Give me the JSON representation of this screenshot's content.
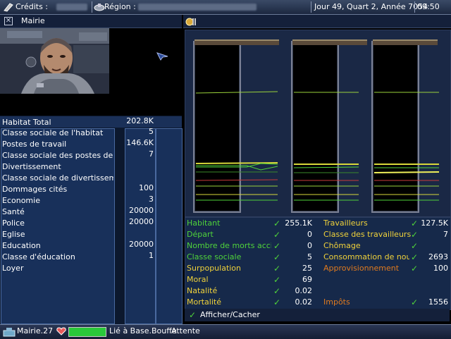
{
  "topbar": {
    "credits_label": "Crédits :",
    "region_label": "Région :",
    "date": "Jour 49, Quart 2, Année 7054",
    "clock": "09:50"
  },
  "left_panel": {
    "title": "Mairie",
    "rows": [
      {
        "label": "Habitat Total",
        "value": "202.8K"
      },
      {
        "label": "Classe sociale de l'habitat",
        "value": "5"
      },
      {
        "label": "Postes de travail",
        "value": "146.6K"
      },
      {
        "label": "Classe sociale des postes de trav",
        "value": "7"
      },
      {
        "label": "Divertissement",
        "value": ""
      },
      {
        "label": "Classe sociale de divertissement",
        "value": ""
      },
      {
        "label": "Dommages cités",
        "value": "100"
      },
      {
        "label": "Economie",
        "value": "3"
      },
      {
        "label": "Santé",
        "value": "20000"
      },
      {
        "label": "Police",
        "value": "20000"
      },
      {
        "label": "Eglise",
        "value": ""
      },
      {
        "label": "Education",
        "value": "20000"
      },
      {
        "label": "Classe d'éducation",
        "value": "1"
      },
      {
        "label": "Loyer",
        "value": ""
      }
    ]
  },
  "stats": {
    "left": [
      {
        "label": "Habitant",
        "value": "255.1K"
      },
      {
        "label": "Départ",
        "value": "0"
      },
      {
        "label": "Nombre de morts acciden",
        "value": "0"
      },
      {
        "label": "Classe sociale",
        "value": "5"
      },
      {
        "label": "Surpopulation",
        "value": "25"
      },
      {
        "label": "Moral",
        "value": "69"
      },
      {
        "label": "Natalité",
        "value": "0.02"
      },
      {
        "label": "Mortalité",
        "value": "0.02"
      }
    ],
    "right": [
      {
        "label": "Travailleurs",
        "value": "127.5K"
      },
      {
        "label": "Classe des travailleurs",
        "value": "7"
      },
      {
        "label": "Chômage",
        "value": ""
      },
      {
        "label": "Consommation de nourrit",
        "value": "2693"
      },
      {
        "label": "Approvisionnement",
        "value": "100"
      },
      {
        "label": "Impôts",
        "value": "1556"
      }
    ]
  },
  "toggle_label": "Afficher/Cacher",
  "bottombar": {
    "location": "Mairie.27",
    "status1": "Lié à Base.Bouffe",
    "status2": "Attente"
  }
}
